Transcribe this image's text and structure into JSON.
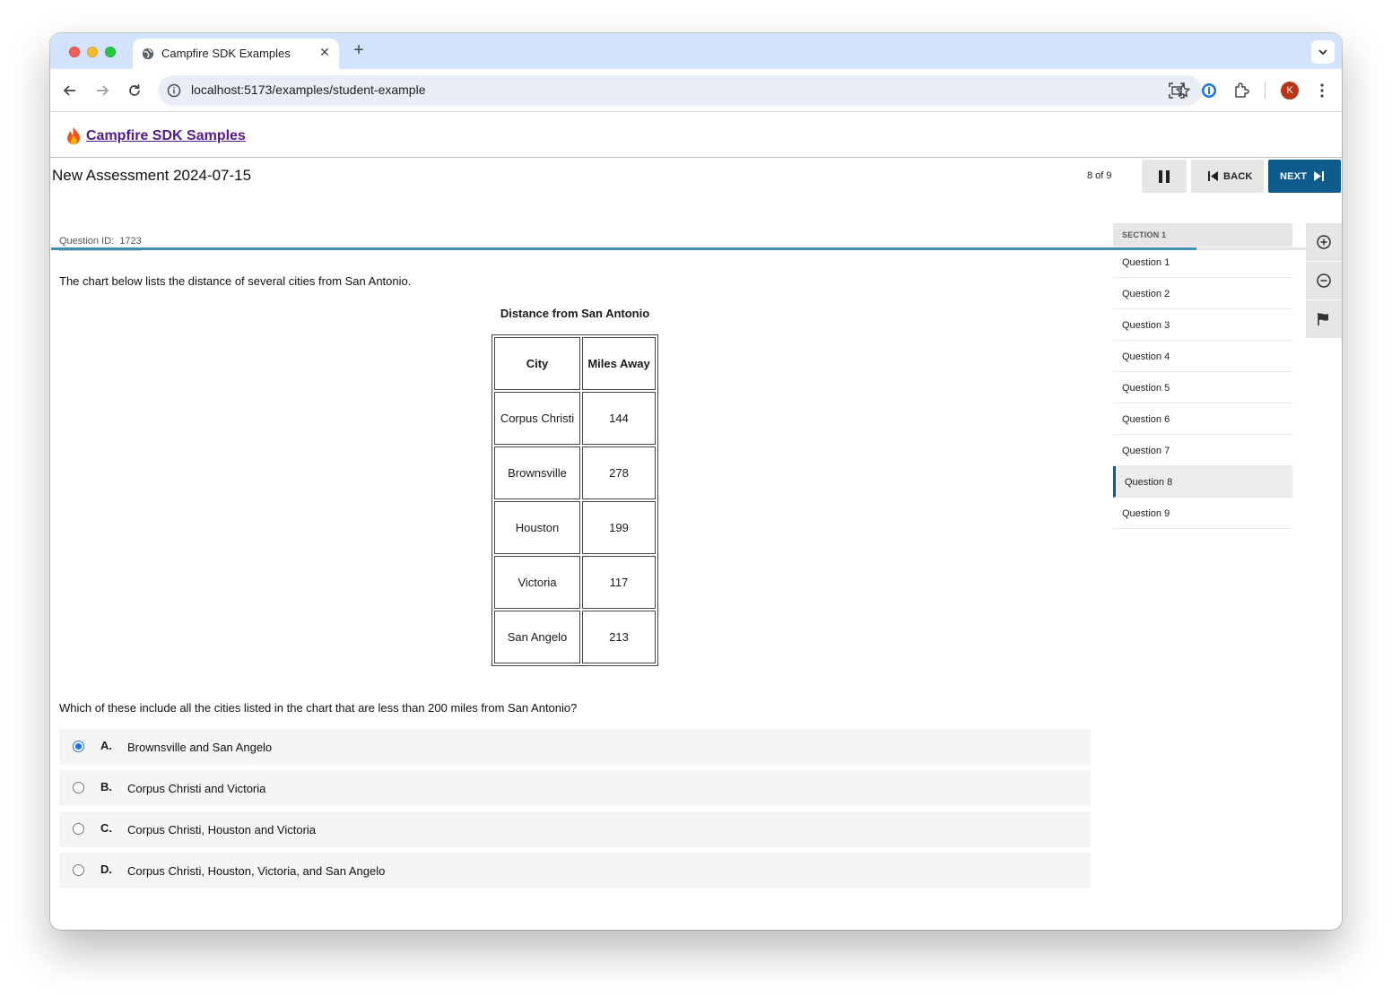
{
  "browser": {
    "tab_title": "Campfire SDK Examples",
    "url": "localhost:5173/examples/student-example",
    "profile_initial": "K"
  },
  "app": {
    "brand_name": "Campfire SDK Samples"
  },
  "assessment": {
    "title": "New Assessment 2024-07-15",
    "counter": "8 of 9",
    "back_label": "BACK",
    "next_label": "NEXT",
    "progress_fraction": 0.888
  },
  "question": {
    "id_label": "Question ID:",
    "id_value": "1723",
    "prompt": "The chart below lists the distance of several cities from San Antonio.",
    "table_caption": "Distance from San Antonio",
    "table_headers": [
      "City",
      "Miles Away"
    ],
    "table_rows": [
      [
        "Corpus Christi",
        "144"
      ],
      [
        "Brownsville",
        "278"
      ],
      [
        "Houston",
        "199"
      ],
      [
        "Victoria",
        "117"
      ],
      [
        "San Angelo",
        "213"
      ]
    ],
    "stem": "Which of these include all the cities listed in the chart that are less than 200 miles from San Antonio?",
    "choices": [
      {
        "letter": "A.",
        "text": "Brownsville and San Angelo",
        "selected": true
      },
      {
        "letter": "B.",
        "text": "Corpus Christi and Victoria",
        "selected": false
      },
      {
        "letter": "C.",
        "text": "Corpus Christi, Houston and Victoria",
        "selected": false
      },
      {
        "letter": "D.",
        "text": "Corpus Christi, Houston, Victoria, and San Angelo",
        "selected": false
      }
    ]
  },
  "sidebar": {
    "section_label": "SECTION 1",
    "items": [
      {
        "label": "Question 1",
        "current": false
      },
      {
        "label": "Question 2",
        "current": false
      },
      {
        "label": "Question 3",
        "current": false
      },
      {
        "label": "Question 4",
        "current": false
      },
      {
        "label": "Question 5",
        "current": false
      },
      {
        "label": "Question 6",
        "current": false
      },
      {
        "label": "Question 7",
        "current": false
      },
      {
        "label": "Question 8",
        "current": true
      },
      {
        "label": "Question 9",
        "current": false
      }
    ]
  },
  "tools": [
    "zoom-in-icon",
    "zoom-out-icon",
    "flag-icon"
  ],
  "colors": {
    "primary": "#0f5c8c",
    "progress": "#3f8fb5",
    "selected_radio": "#1a73e8",
    "brand_link": "#551a8b"
  }
}
